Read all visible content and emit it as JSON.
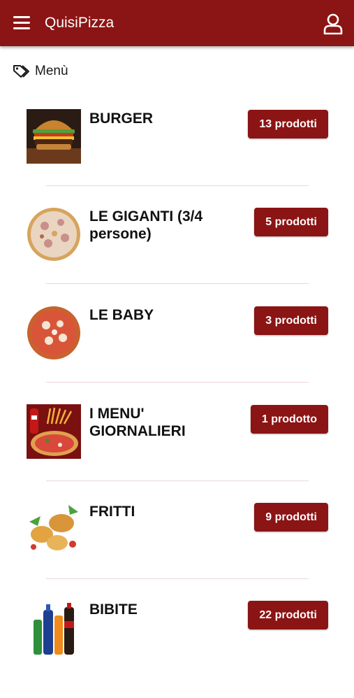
{
  "app": {
    "title": "QuisiPizza"
  },
  "section": {
    "title": "Menù"
  },
  "colors": {
    "brand": "#8b1414",
    "divider": "#f0d4d8"
  },
  "categories": [
    {
      "name": "BURGER",
      "count": "13 prodotti",
      "image": "burger-photo"
    },
    {
      "name": "LE GIGANTI (3/4 persone)",
      "count": "5 prodotti",
      "image": "pizza-large-photo"
    },
    {
      "name": "LE BABY",
      "count": "3 prodotti",
      "image": "pizza-small-photo"
    },
    {
      "name": "I MENU' GIORNALIERI",
      "count": "1 prodotto",
      "image": "daily-menu-photo"
    },
    {
      "name": "FRITTI",
      "count": "9 prodotti",
      "image": "fried-food-photo"
    },
    {
      "name": "BIBITE",
      "count": "22 prodotti",
      "image": "drinks-photo"
    }
  ]
}
